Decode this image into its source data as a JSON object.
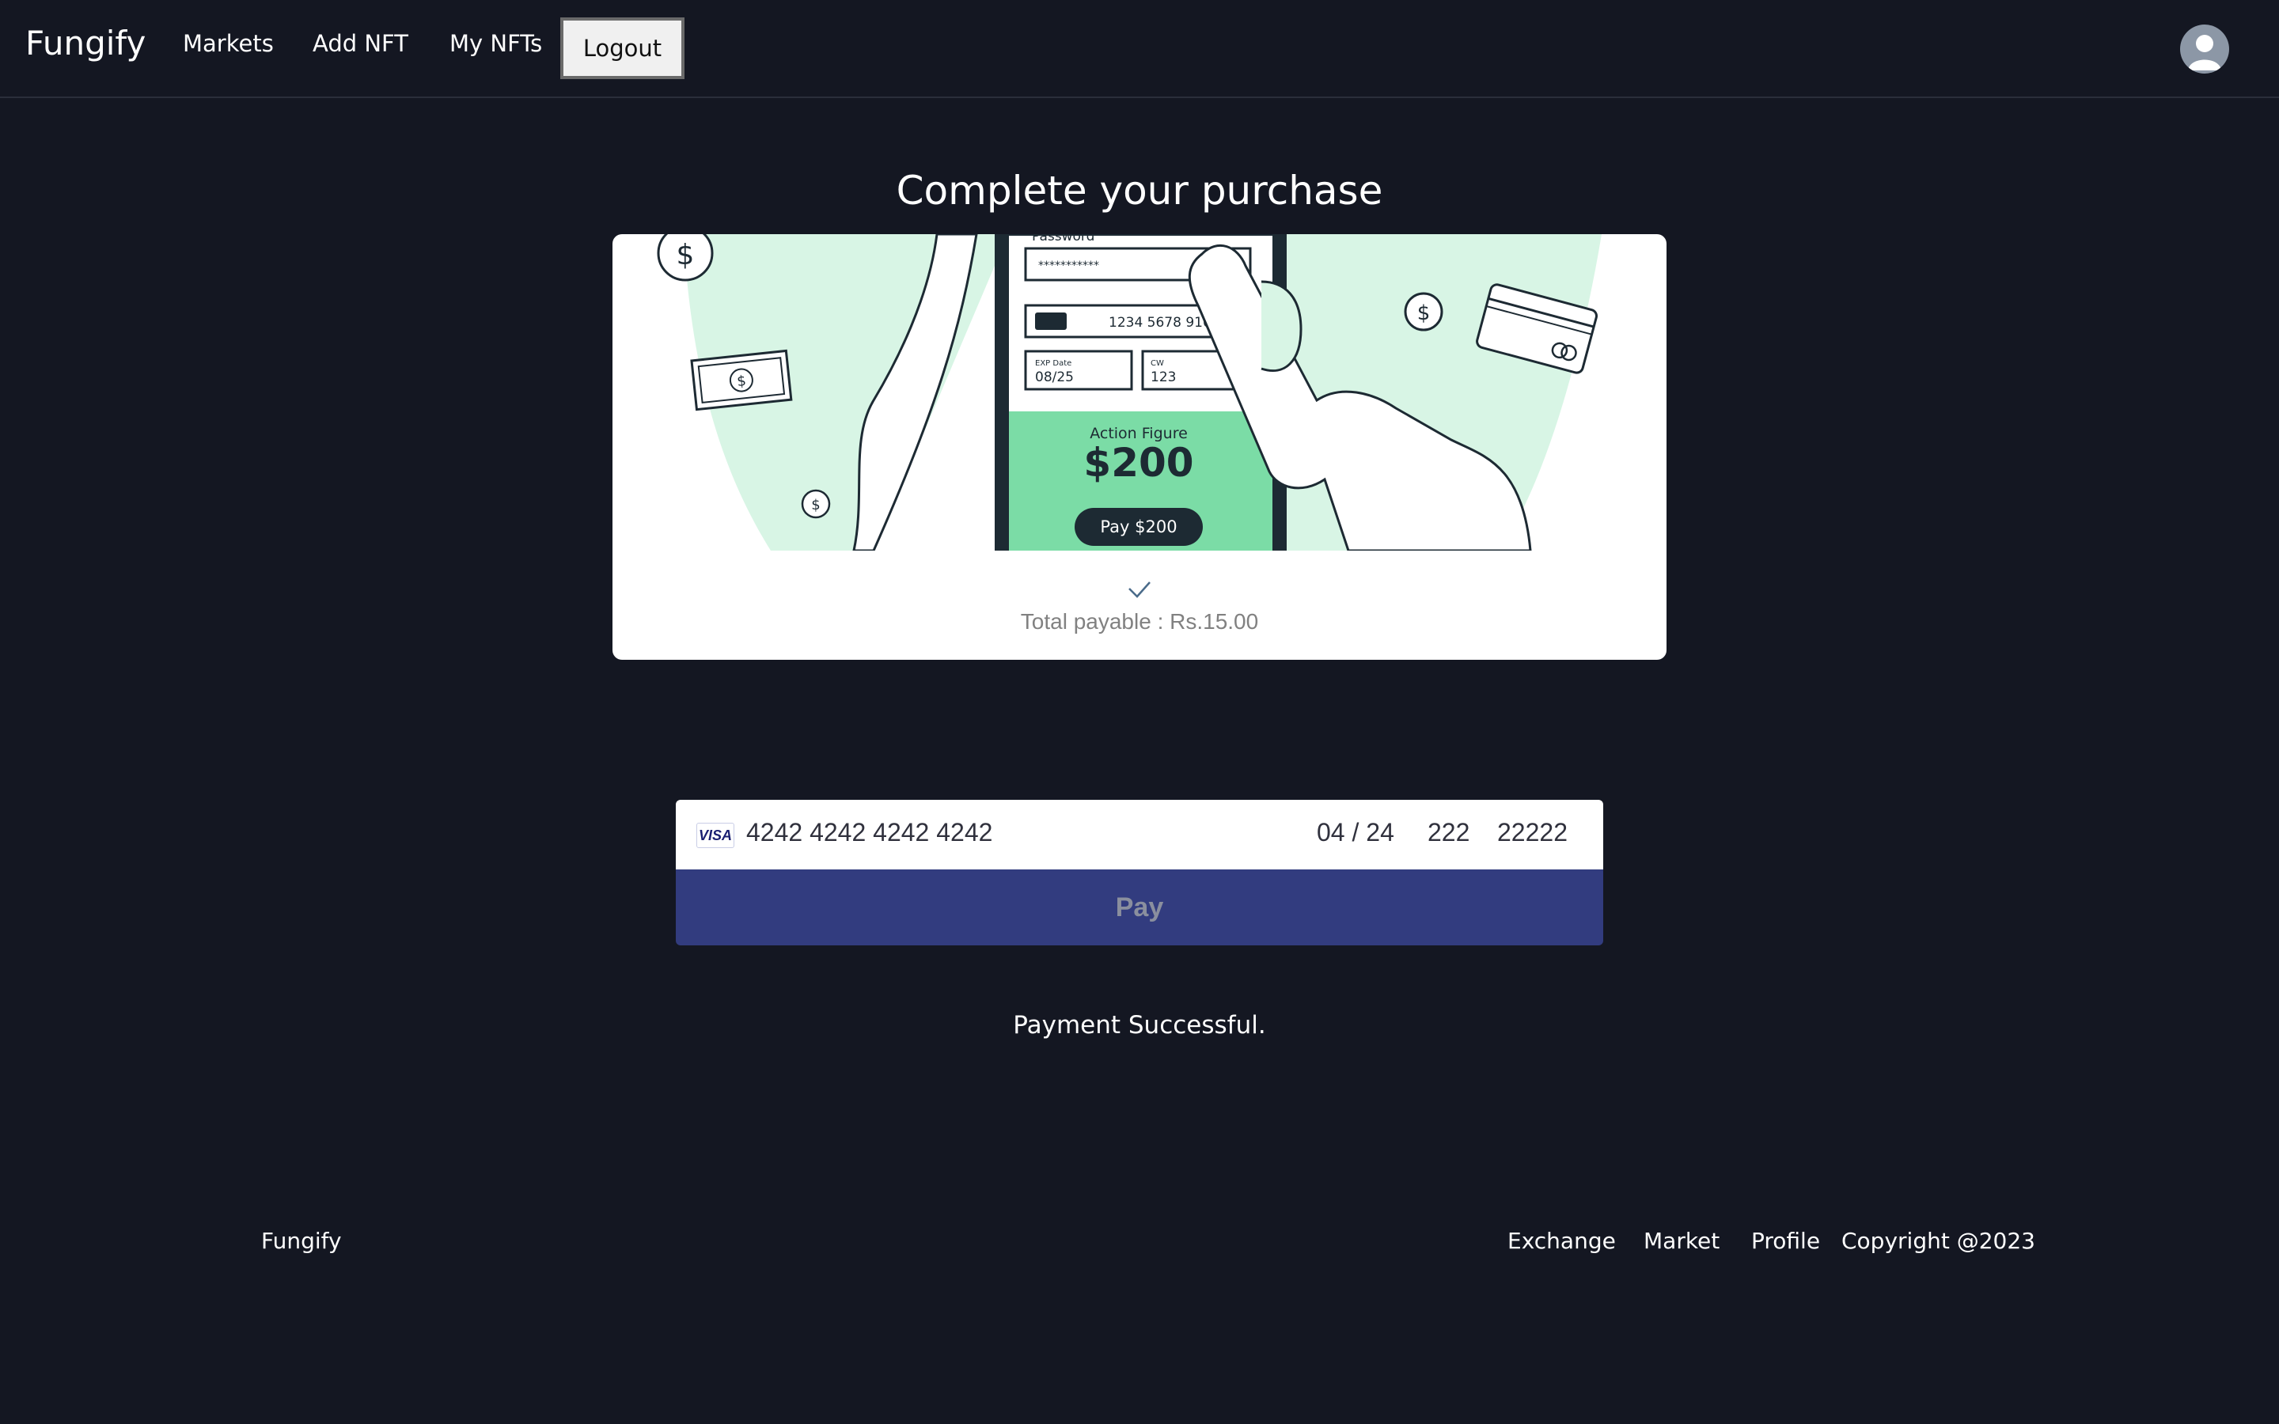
{
  "header": {
    "brand": "Fungify",
    "nav": [
      "Markets",
      "Add NFT",
      "My NFTs"
    ],
    "logout_label": "Logout"
  },
  "page": {
    "title": "Complete your purchase"
  },
  "illustration": {
    "password_label": "Password",
    "password_value": "***********",
    "card_number": "1234 5678 910",
    "exp_label": "EXP Date",
    "exp_value": "08/25",
    "cvv_label": "CW",
    "cvv_value": "123",
    "product": "Action Figure",
    "price": "$200",
    "pay_button": "Pay $200"
  },
  "summary": {
    "total": "Total payable : Rs.15.00"
  },
  "payment": {
    "card_brand": "VISA",
    "card_number": "4242 4242 4242 4242",
    "expiry": "04 / 24",
    "cvc": "222",
    "zip": "22222",
    "pay_label": "Pay"
  },
  "status": "Payment Successful.",
  "footer": {
    "brand": "Fungify",
    "links": [
      "Exchange",
      "Market",
      "Profile"
    ],
    "copyright": "Copyright @2023"
  },
  "colors": {
    "background": "#141722",
    "pay_button": "#323c7f",
    "illustration_green": "#d8f5e5",
    "illustration_mid_green": "#7bdca6"
  }
}
